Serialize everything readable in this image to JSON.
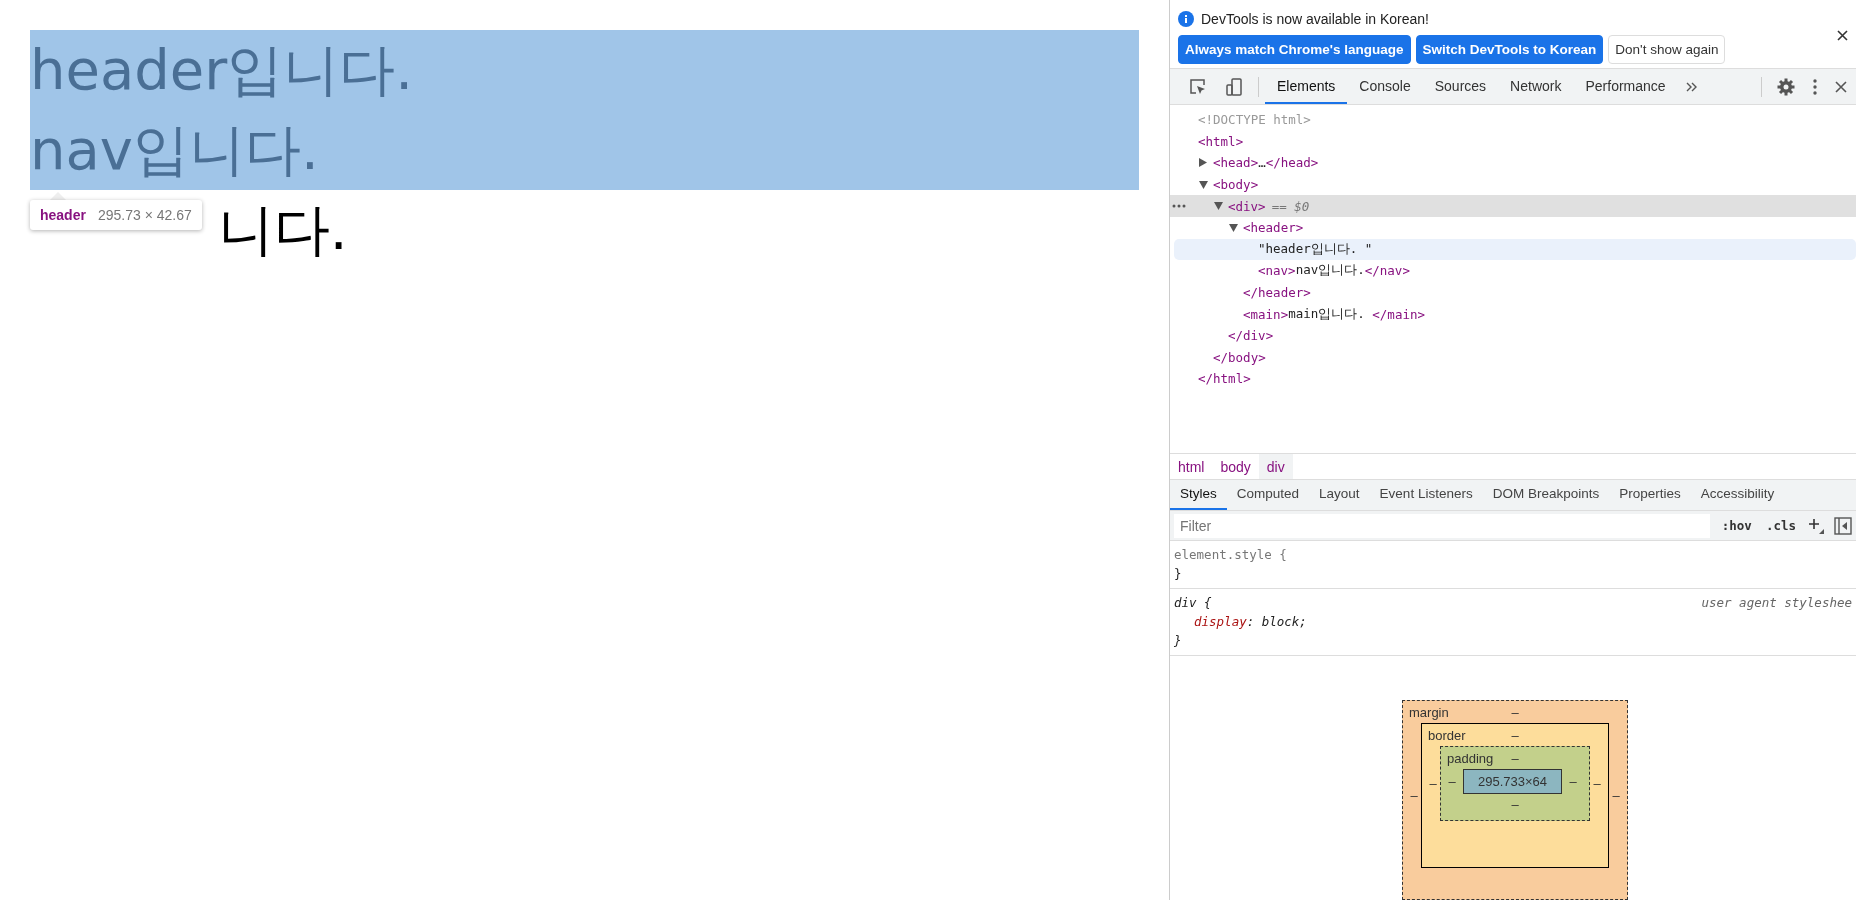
{
  "page": {
    "lines": [
      {
        "text": "header입니다.",
        "highlighted": true
      },
      {
        "text": "nav입니다.",
        "highlighted": true
      },
      {
        "text": "니다.",
        "highlighted": false
      }
    ],
    "tooltip": {
      "tag": "header",
      "size": "295.73 × 42.67"
    }
  },
  "infobar": {
    "message": "DevTools is now available in Korean!",
    "buttons": [
      {
        "label": "Always match Chrome's language",
        "kind": "primary"
      },
      {
        "label": "Switch DevTools to Korean",
        "kind": "primary"
      },
      {
        "label": "Don't show again",
        "kind": "secondary"
      }
    ]
  },
  "toolbar": {
    "tabs": [
      {
        "label": "Elements",
        "selected": true
      },
      {
        "label": "Console",
        "selected": false
      },
      {
        "label": "Sources",
        "selected": false
      },
      {
        "label": "Network",
        "selected": false
      },
      {
        "label": "Performance",
        "selected": false
      }
    ]
  },
  "dom_tree": [
    {
      "kind": "doctype",
      "open": "<!DOCTYPE html>",
      "selected": false,
      "hovered": false
    },
    {
      "kind": "element",
      "open": "<html>",
      "close": "</html>",
      "selected": false,
      "hovered": false,
      "children": [
        {
          "kind": "element",
          "open": "<head>",
          "inner": "…",
          "close": "</head>",
          "expanded": false,
          "selected": false,
          "hovered": false
        },
        {
          "kind": "element",
          "open": "<body>",
          "close": "</body>",
          "expanded": true,
          "selected": false,
          "hovered": false,
          "children": [
            {
              "kind": "element",
              "open": "<div>",
              "note": "== $0",
              "close": "</div>",
              "expanded": true,
              "selected": true,
              "hovered": false,
              "children": [
                {
                  "kind": "element",
                  "open": "<header>",
                  "close": "</header>",
                  "expanded": true,
                  "selected": false,
                  "hovered": false,
                  "children": [
                    {
                      "kind": "text",
                      "open": "\"header입니다. \"",
                      "selected": false,
                      "hovered": true
                    },
                    {
                      "kind": "element",
                      "open": "<nav>",
                      "inner": "nav입니다.",
                      "close": "</nav>",
                      "selected": false,
                      "hovered": false
                    }
                  ]
                },
                {
                  "kind": "element",
                  "open": "<main>",
                  "inner": "main입니다. ",
                  "close": "</main>",
                  "selected": false,
                  "hovered": false
                }
              ]
            }
          ]
        }
      ]
    }
  ],
  "breadcrumb": [
    {
      "label": "html",
      "selected": false
    },
    {
      "label": "body",
      "selected": false
    },
    {
      "label": "div",
      "selected": true
    }
  ],
  "styles_tabs": [
    {
      "label": "Styles",
      "selected": true
    },
    {
      "label": "Computed",
      "selected": false
    },
    {
      "label": "Layout",
      "selected": false
    },
    {
      "label": "Event Listeners",
      "selected": false
    },
    {
      "label": "DOM Breakpoints",
      "selected": false
    },
    {
      "label": "Properties",
      "selected": false
    },
    {
      "label": "Accessibility",
      "selected": false
    }
  ],
  "filter": {
    "placeholder": "Filter",
    "buttons": [
      ":hov",
      ".cls"
    ]
  },
  "rules": [
    {
      "kind": "inline",
      "selector": "element.style {",
      "end": "}"
    },
    {
      "kind": "user_agent",
      "selector": "div {",
      "source": "user agent styleshee",
      "declarations": [
        {
          "property": "display",
          "separator": ":",
          "value": "block;"
        }
      ],
      "end": "}"
    }
  ],
  "box_model": {
    "margin": {
      "label": "margin",
      "top": "–",
      "left": "–",
      "right": "–"
    },
    "border": {
      "label": "border",
      "top": "–",
      "left": "–",
      "right": "–"
    },
    "padding": {
      "label": "padding",
      "top": "–",
      "left": "–",
      "right": "–",
      "bottom": "–"
    },
    "content": "295.733×64"
  }
}
